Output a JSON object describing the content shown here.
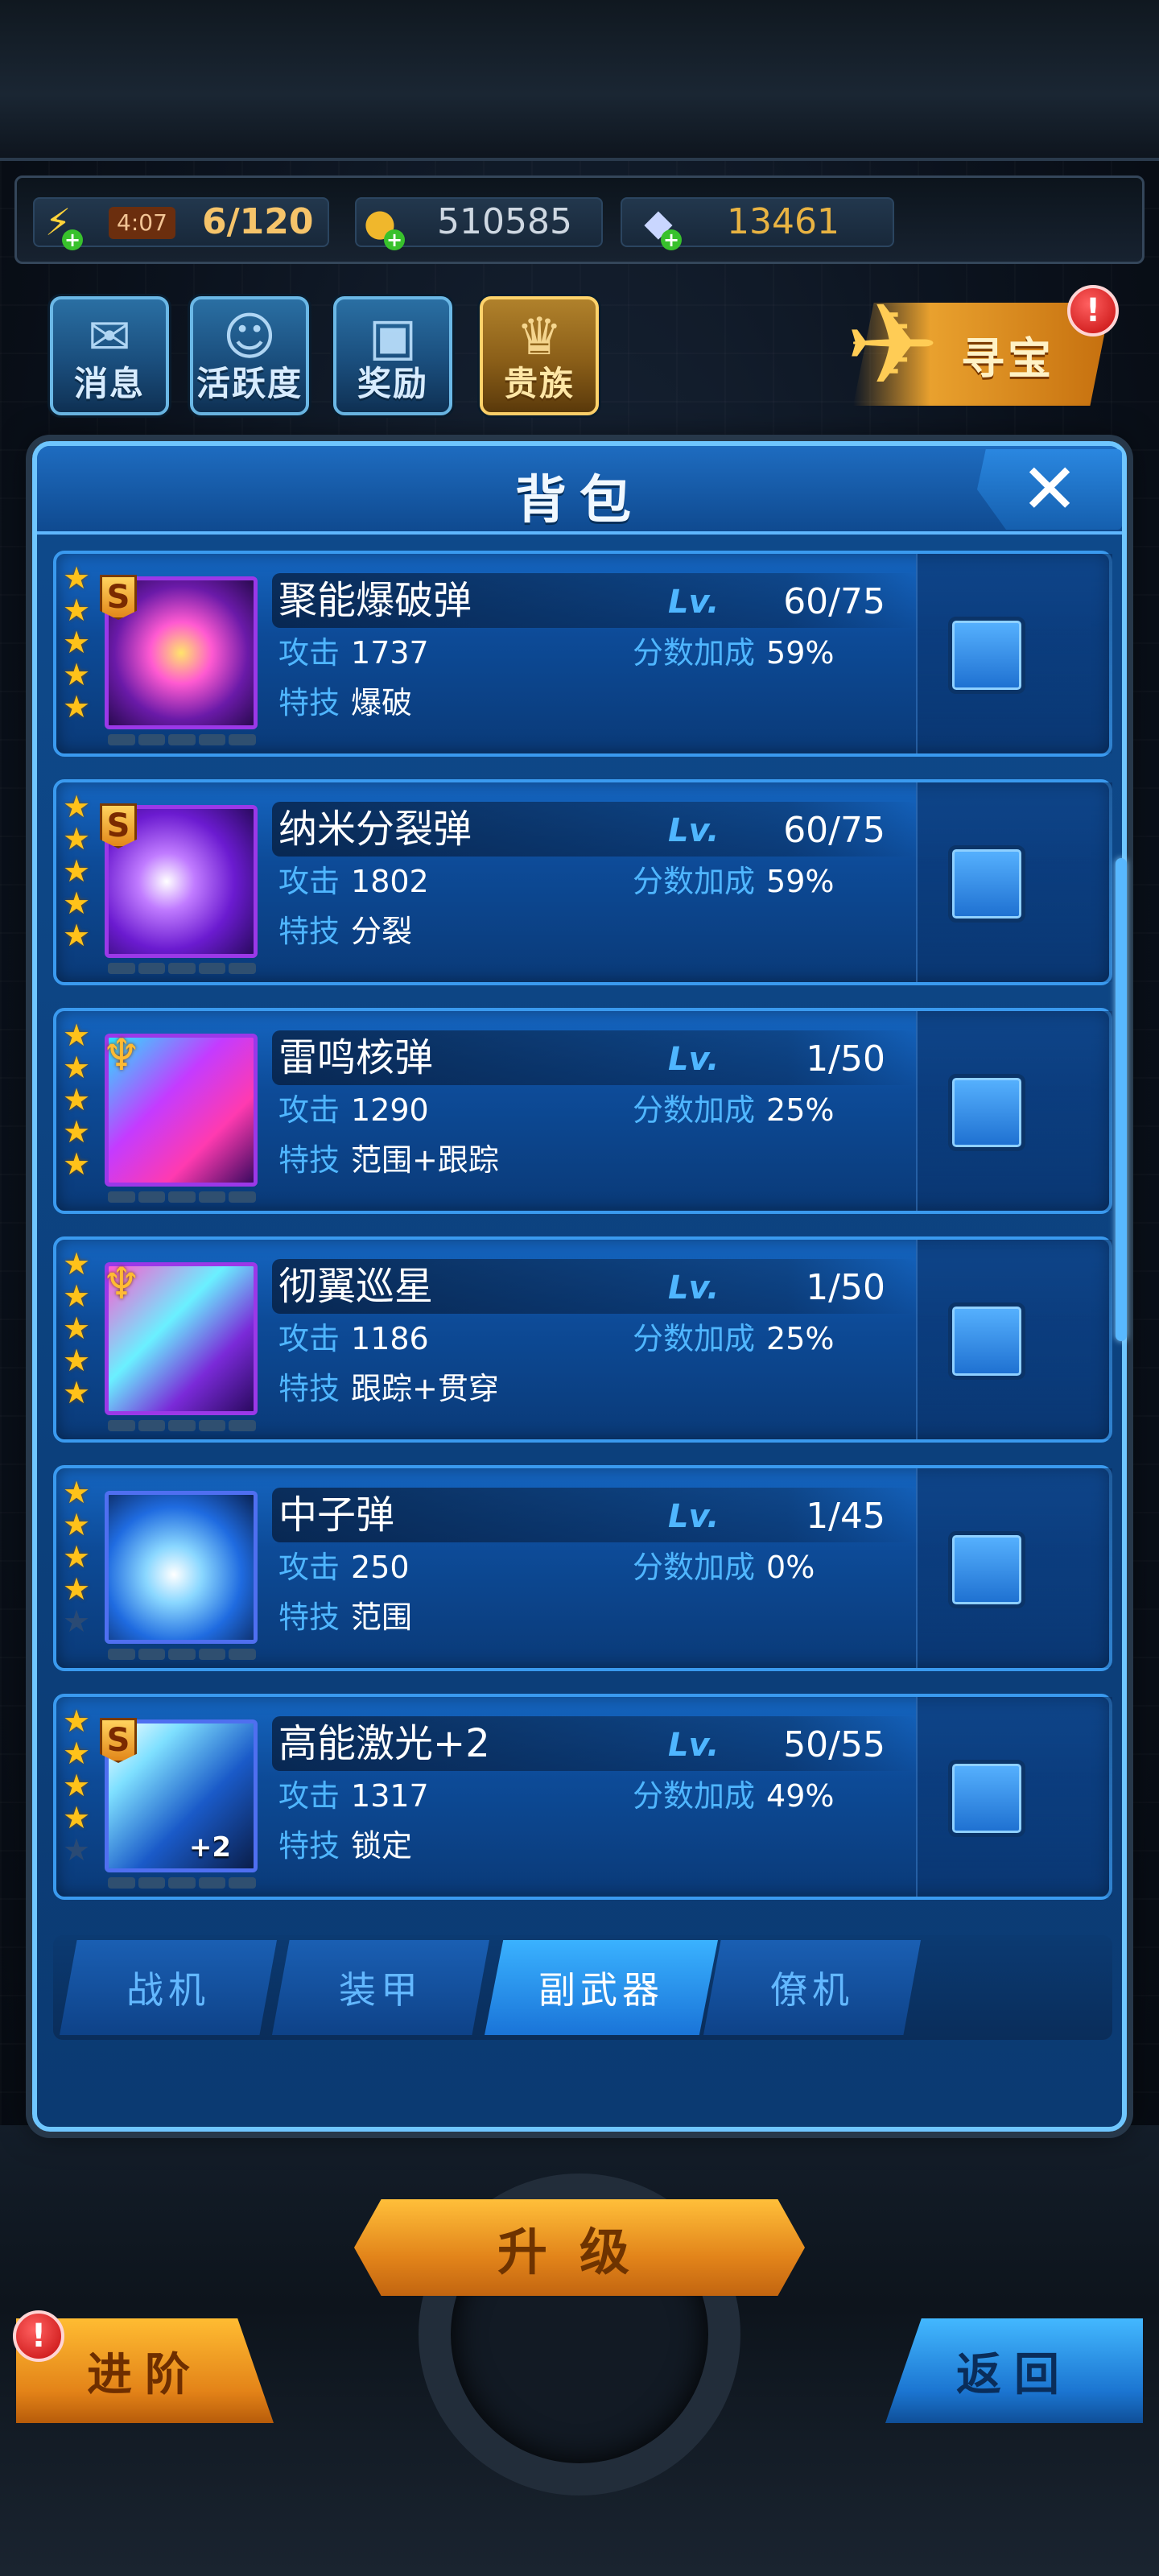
{
  "resources": {
    "energy_timer": "4:07",
    "energy": "6/120",
    "gold": "510585",
    "gems": "13461"
  },
  "top_menu": [
    {
      "label": "消息",
      "icon": "mail-icon"
    },
    {
      "label": "活跃度",
      "icon": "smile-icon"
    },
    {
      "label": "奖励",
      "icon": "gift-icon"
    },
    {
      "label": "贵族",
      "icon": "vip-icon"
    }
  ],
  "treasure": {
    "label": "寻宝",
    "badge": "!"
  },
  "panel": {
    "title": "背包",
    "close_icon": "close-icon"
  },
  "items": [
    {
      "name": "聚能爆破弹",
      "lv_label": "Lv.",
      "level": "60/75",
      "attack_label": "攻击",
      "attack": "1737",
      "bonus_label": "分数加成",
      "bonus": "59%",
      "skill_label": "特技",
      "skill": "爆破",
      "grade": "S",
      "stars": 5
    },
    {
      "name": "纳米分裂弹",
      "lv_label": "Lv.",
      "level": "60/75",
      "attack_label": "攻击",
      "attack": "1802",
      "bonus_label": "分数加成",
      "bonus": "59%",
      "skill_label": "特技",
      "skill": "分裂",
      "grade": "S",
      "stars": 5
    },
    {
      "name": "雷鸣核弹",
      "lv_label": "Lv.",
      "level": "1/50",
      "attack_label": "攻击",
      "attack": "1290",
      "bonus_label": "分数加成",
      "bonus": "25%",
      "skill_label": "特技",
      "skill": "范围+跟踪",
      "grade": "W",
      "stars": 5
    },
    {
      "name": "彻翼巡星",
      "lv_label": "Lv.",
      "level": "1/50",
      "attack_label": "攻击",
      "attack": "1186",
      "bonus_label": "分数加成",
      "bonus": "25%",
      "skill_label": "特技",
      "skill": "跟踪+贯穿",
      "grade": "W",
      "stars": 5
    },
    {
      "name": "中子弹",
      "lv_label": "Lv.",
      "level": "1/45",
      "attack_label": "攻击",
      "attack": "250",
      "bonus_label": "分数加成",
      "bonus": "0%",
      "skill_label": "特技",
      "skill": "范围",
      "grade": "",
      "stars": 4
    },
    {
      "name": "高能激光+2",
      "lv_label": "Lv.",
      "level": "50/55",
      "attack_label": "攻击",
      "attack": "1317",
      "bonus_label": "分数加成",
      "bonus": "49%",
      "skill_label": "特技",
      "skill": "锁定",
      "grade": "S",
      "stars": 4,
      "thumb_badge": "+2"
    }
  ],
  "tabs": [
    {
      "label": "战机",
      "active": false
    },
    {
      "label": "装甲",
      "active": false
    },
    {
      "label": "副武器",
      "active": true
    },
    {
      "label": "僚机",
      "active": false
    }
  ],
  "bottom": {
    "upgrade": "升级",
    "advance": "进阶",
    "advance_badge": "!",
    "back": "返回"
  },
  "colors": {
    "accent_blue": "#4fb6ff",
    "panel_border": "#6fc6ff",
    "gold_button": "#e2841a",
    "star": "#ffc21a"
  }
}
